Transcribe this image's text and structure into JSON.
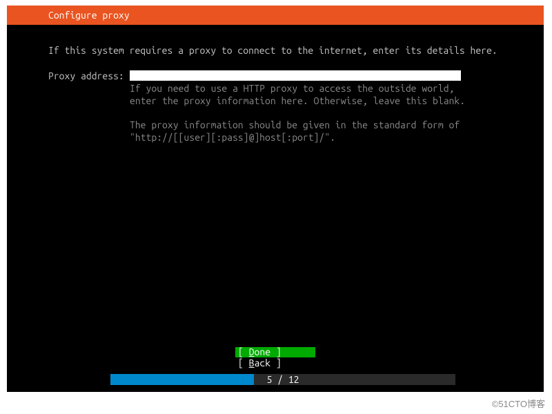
{
  "header": {
    "title": "Configure proxy"
  },
  "intro": "If this system requires a proxy to connect to the internet, enter its details here.",
  "field": {
    "label": "Proxy address:",
    "value": "",
    "help1": "If you need to use a HTTP proxy to access the outside world, enter the proxy information here. Otherwise, leave this blank.",
    "help2": "The proxy information should be given in the standard form of \"http://[[user][:pass]@]host[:port]/\"."
  },
  "buttons": {
    "done_open": "[ ",
    "done_first": "D",
    "done_rest": "one",
    "done_close": "      ]",
    "back_open": "[ ",
    "back_first": "B",
    "back_rest": "ack",
    "back_close": "      ]"
  },
  "progress": {
    "current": 5,
    "total": 12,
    "label": "5 / 12",
    "percent": 41.6
  },
  "watermark": "©51CTO博客"
}
